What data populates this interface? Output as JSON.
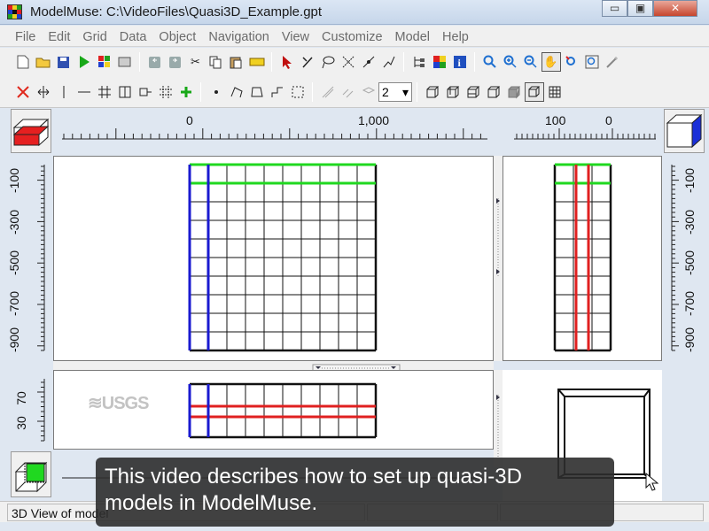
{
  "window": {
    "title": "ModelMuse: C:\\VideoFiles\\Quasi3D_Example.gpt",
    "minimize_glyph": "▭",
    "maximize_glyph": "▣",
    "close_glyph": "✕"
  },
  "menu": [
    "File",
    "Edit",
    "Grid",
    "Data",
    "Object",
    "Navigation",
    "View",
    "Customize",
    "Model",
    "Help"
  ],
  "toolbar": {
    "row1_icons": [
      "new-file-icon",
      "open-file-icon",
      "save-icon",
      "run-model-icon",
      "export-model-icon",
      "import-icon",
      "undo-icon",
      "redo-icon",
      "cut-icon",
      "copy-icon",
      "paste-icon",
      "measure-ruler-icon",
      "select-arrow-icon",
      "select-point-icon",
      "lasso-icon",
      "move-nodes-icon",
      "insert-node-icon",
      "delete-segment-icon",
      "object-tree-icon",
      "color-grid-icon",
      "info-icon",
      "zoom-icon",
      "zoom-in-icon",
      "zoom-out-icon",
      "pan-hand-icon",
      "restore-zoom-icon",
      "zoom-extents-icon",
      "magic-wand-icon"
    ],
    "row2_icons": [
      "delete-grid-line-icon",
      "move-grid-line-icon",
      "add-vertical-line-icon",
      "add-horizontal-line-icon",
      "generate-grid-icon",
      "subdivide-icon",
      "spacing-icon",
      "select-cells-icon",
      "add-grid-line-icon",
      "point-object-icon",
      "polyline-object-icon",
      "polygon-object-icon",
      "step-line-icon",
      "rectangle-select-icon",
      "column-select-icon",
      "row-select-icon",
      "layer-select-icon",
      "cube-view-front-icon",
      "cube-view-side-icon",
      "cube-view-top-icon",
      "cube-view-iso-icon",
      "shaded-solid-icon",
      "wireframe-icon",
      "grid-toggle-icon"
    ],
    "layer_combo_value": "2",
    "accent_colors": {
      "green": "#18a818",
      "red": "#e0281c",
      "blue": "#1f4fbf"
    }
  },
  "top_view": {
    "ruler_labels": [
      "0",
      "1,000"
    ],
    "y_ruler_labels": [
      "-100",
      "-300",
      "-500",
      "-700",
      "-900"
    ]
  },
  "side_view": {
    "ruler_labels": [
      "100",
      "0"
    ],
    "y_ruler_labels": [
      "-100",
      "-300",
      "-500",
      "-700",
      "-900"
    ]
  },
  "front_view": {
    "y_ruler_labels": [
      "30",
      "70"
    ],
    "logo_text": "≋USGS"
  },
  "colors": {
    "grid_green": "#1fd81f",
    "grid_red": "#e02020",
    "grid_blue": "#1a1ad0",
    "cube_red": "#e52020",
    "cube_blue": "#1a2fd8",
    "cube_green": "#20d820"
  },
  "status": {
    "left_text": "3D View of model"
  },
  "caption": {
    "line1": "This video describes how to set up quasi-3D",
    "line2": "models in ModelMuse."
  }
}
